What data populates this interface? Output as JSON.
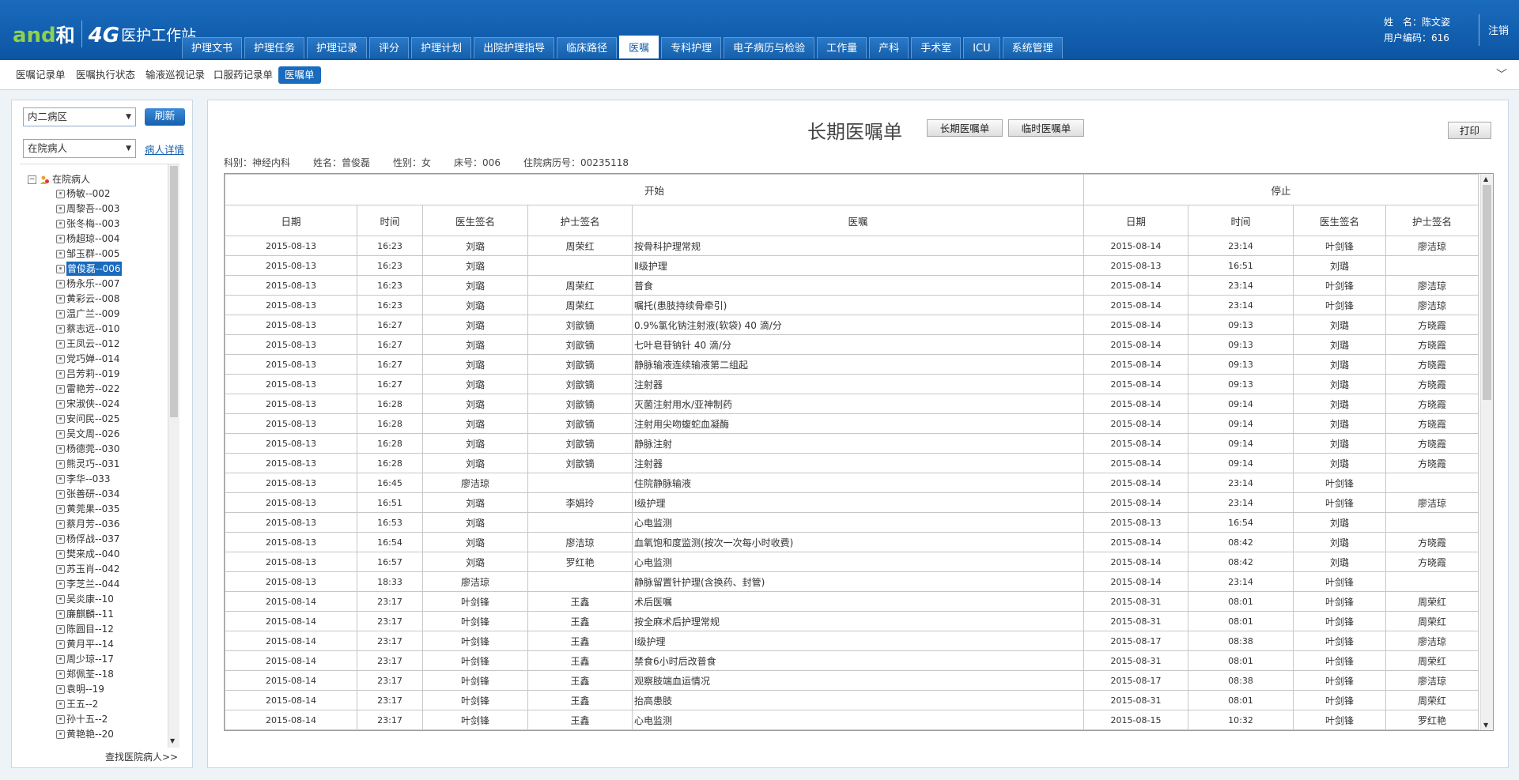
{
  "header": {
    "logo_and": "and",
    "logo_hex": "和",
    "logo_4g": "4G",
    "app_title": "医护工作站",
    "nav_tabs": [
      {
        "label": "护理文书"
      },
      {
        "label": "护理任务"
      },
      {
        "label": "护理记录"
      },
      {
        "label": "评分"
      },
      {
        "label": "护理计划"
      },
      {
        "label": "出院护理指导"
      },
      {
        "label": "临床路径"
      },
      {
        "label": "医嘱"
      },
      {
        "label": "专科护理"
      },
      {
        "label": "电子病历与检验"
      },
      {
        "label": "工作量"
      },
      {
        "label": "产科"
      },
      {
        "label": "手术室"
      },
      {
        "label": "ICU"
      },
      {
        "label": "系统管理"
      }
    ],
    "active_tab": "医嘱",
    "user_name_label": "姓　名：陈文姿",
    "user_code_label": "用户编码：616",
    "logout": "注销"
  },
  "subbar": {
    "tabs": [
      {
        "label": "医嘱记录单"
      },
      {
        "label": "医嘱执行状态"
      },
      {
        "label": "输液巡视记录"
      },
      {
        "label": "口服药记录单"
      },
      {
        "label": "医嘱单"
      }
    ],
    "active_tab": "医嘱单"
  },
  "left": {
    "ward_select": "内二病区",
    "refresh": "刷新",
    "patient_filter": "在院病人",
    "patient_detail": "病人详情",
    "tree_root": "在院病人",
    "patients": [
      "杨敏--002",
      "周黎吾--003",
      "张冬梅--003",
      "杨超琼--004",
      "邹玉群--005",
      "曾俊磊--006",
      "杨永乐--007",
      "黄彩云--008",
      "温广兰--009",
      "蔡志远--010",
      "王凤云--012",
      "党巧婵--014",
      "吕芳莉--019",
      "雷艳芳--022",
      "宋淑侠--024",
      "安问民--025",
      "吴文周--026",
      "杨德莞--030",
      "熊灵巧--031",
      "李华--033",
      "张善研--034",
      "黄莞果--035",
      "蔡月芳--036",
      "杨俘战--037",
      "樊来成--040",
      "苏玉肖--042",
      "李芝兰--044",
      "吴炎康--10",
      "廉麒麟--11",
      "陈圆目--12",
      "黄月平--14",
      "周少琼--17",
      "郑佩荃--18",
      "袁明--19",
      "王五--2",
      "孙十五--2",
      "黄艳艳--20"
    ],
    "selected_patient": "曾俊磊--006",
    "find_discharged": "查找医院病人>>"
  },
  "main": {
    "title": "长期医嘱单",
    "btn_long": "长期医嘱单",
    "btn_temp": "临时医嘱单",
    "btn_print": "打印",
    "patient_info": {
      "dept": "科别：神经内科",
      "name": "姓名：曾俊磊",
      "sex": "性别：女",
      "bed": "床号：006",
      "record_no": "住院病历号：00235118"
    },
    "table": {
      "group_start": "开始",
      "group_stop": "停止",
      "headers": [
        "日期",
        "时间",
        "医生签名",
        "护士签名",
        "医嘱",
        "日期",
        "时间",
        "医生签名",
        "护士签名"
      ],
      "rows": [
        [
          "2015-08-13",
          "16:23",
          "刘璐",
          "周荣红",
          "按骨科护理常规",
          "2015-08-14",
          "23:14",
          "叶剑锋",
          "廖洁琼"
        ],
        [
          "2015-08-13",
          "16:23",
          "刘璐",
          "",
          "Ⅱ级护理",
          "2015-08-13",
          "16:51",
          "刘璐",
          ""
        ],
        [
          "2015-08-13",
          "16:23",
          "刘璐",
          "周荣红",
          "普食",
          "2015-08-14",
          "23:14",
          "叶剑锋",
          "廖洁琼"
        ],
        [
          "2015-08-13",
          "16:23",
          "刘璐",
          "周荣红",
          "嘱托(患肢持续骨牵引)",
          "2015-08-14",
          "23:14",
          "叶剑锋",
          "廖洁琼"
        ],
        [
          "2015-08-13",
          "16:27",
          "刘璐",
          "刘歆镝",
          "0.9%氯化钠注射液(软袋) 40 滴/分",
          "2015-08-14",
          "09:13",
          "刘璐",
          "方晓霞"
        ],
        [
          "2015-08-13",
          "16:27",
          "刘璐",
          "刘歆镝",
          "七叶皂苷钠针 40 滴/分",
          "2015-08-14",
          "09:13",
          "刘璐",
          "方晓霞"
        ],
        [
          "2015-08-13",
          "16:27",
          "刘璐",
          "刘歆镝",
          "静脉输液连续输液第二组起",
          "2015-08-14",
          "09:13",
          "刘璐",
          "方晓霞"
        ],
        [
          "2015-08-13",
          "16:27",
          "刘璐",
          "刘歆镝",
          "注射器",
          "2015-08-14",
          "09:13",
          "刘璐",
          "方晓霞"
        ],
        [
          "2015-08-13",
          "16:28",
          "刘璐",
          "刘歆镝",
          "灭菌注射用水/亚神制药",
          "2015-08-14",
          "09:14",
          "刘璐",
          "方晓霞"
        ],
        [
          "2015-08-13",
          "16:28",
          "刘璐",
          "刘歆镝",
          "注射用尖吻蝮蛇血凝酶",
          "2015-08-14",
          "09:14",
          "刘璐",
          "方晓霞"
        ],
        [
          "2015-08-13",
          "16:28",
          "刘璐",
          "刘歆镝",
          "静脉注射",
          "2015-08-14",
          "09:14",
          "刘璐",
          "方晓霞"
        ],
        [
          "2015-08-13",
          "16:28",
          "刘璐",
          "刘歆镝",
          "注射器",
          "2015-08-14",
          "09:14",
          "刘璐",
          "方晓霞"
        ],
        [
          "2015-08-13",
          "16:45",
          "廖洁琼",
          "",
          "住院静脉输液",
          "2015-08-14",
          "23:14",
          "叶剑锋",
          ""
        ],
        [
          "2015-08-13",
          "16:51",
          "刘璐",
          "李娟玲",
          "Ⅰ级护理",
          "2015-08-14",
          "23:14",
          "叶剑锋",
          "廖洁琼"
        ],
        [
          "2015-08-13",
          "16:53",
          "刘璐",
          "",
          "心电监测",
          "2015-08-13",
          "16:54",
          "刘璐",
          ""
        ],
        [
          "2015-08-13",
          "16:54",
          "刘璐",
          "廖洁琼",
          "血氧饱和度监测(按次一次每小时收费)",
          "2015-08-14",
          "08:42",
          "刘璐",
          "方晓霞"
        ],
        [
          "2015-08-13",
          "16:57",
          "刘璐",
          "罗红艳",
          "心电监测",
          "2015-08-14",
          "08:42",
          "刘璐",
          "方晓霞"
        ],
        [
          "2015-08-13",
          "18:33",
          "廖洁琼",
          "",
          "静脉留置针护理(含换药、封管)",
          "2015-08-14",
          "23:14",
          "叶剑锋",
          ""
        ],
        [
          "2015-08-14",
          "23:17",
          "叶剑锋",
          "王鑫",
          "术后医嘱",
          "2015-08-31",
          "08:01",
          "叶剑锋",
          "周荣红"
        ],
        [
          "2015-08-14",
          "23:17",
          "叶剑锋",
          "王鑫",
          "按全麻术后护理常规",
          "2015-08-31",
          "08:01",
          "叶剑锋",
          "周荣红"
        ],
        [
          "2015-08-14",
          "23:17",
          "叶剑锋",
          "王鑫",
          "Ⅰ级护理",
          "2015-08-17",
          "08:38",
          "叶剑锋",
          "廖洁琼"
        ],
        [
          "2015-08-14",
          "23:17",
          "叶剑锋",
          "王鑫",
          "禁食6小时后改普食",
          "2015-08-31",
          "08:01",
          "叶剑锋",
          "周荣红"
        ],
        [
          "2015-08-14",
          "23:17",
          "叶剑锋",
          "王鑫",
          "观察肢端血运情况",
          "2015-08-17",
          "08:38",
          "叶剑锋",
          "廖洁琼"
        ],
        [
          "2015-08-14",
          "23:17",
          "叶剑锋",
          "王鑫",
          "抬高患肢",
          "2015-08-31",
          "08:01",
          "叶剑锋",
          "周荣红"
        ],
        [
          "2015-08-14",
          "23:17",
          "叶剑锋",
          "王鑫",
          "心电监测",
          "2015-08-15",
          "10:32",
          "叶剑锋",
          "罗红艳"
        ]
      ]
    }
  }
}
